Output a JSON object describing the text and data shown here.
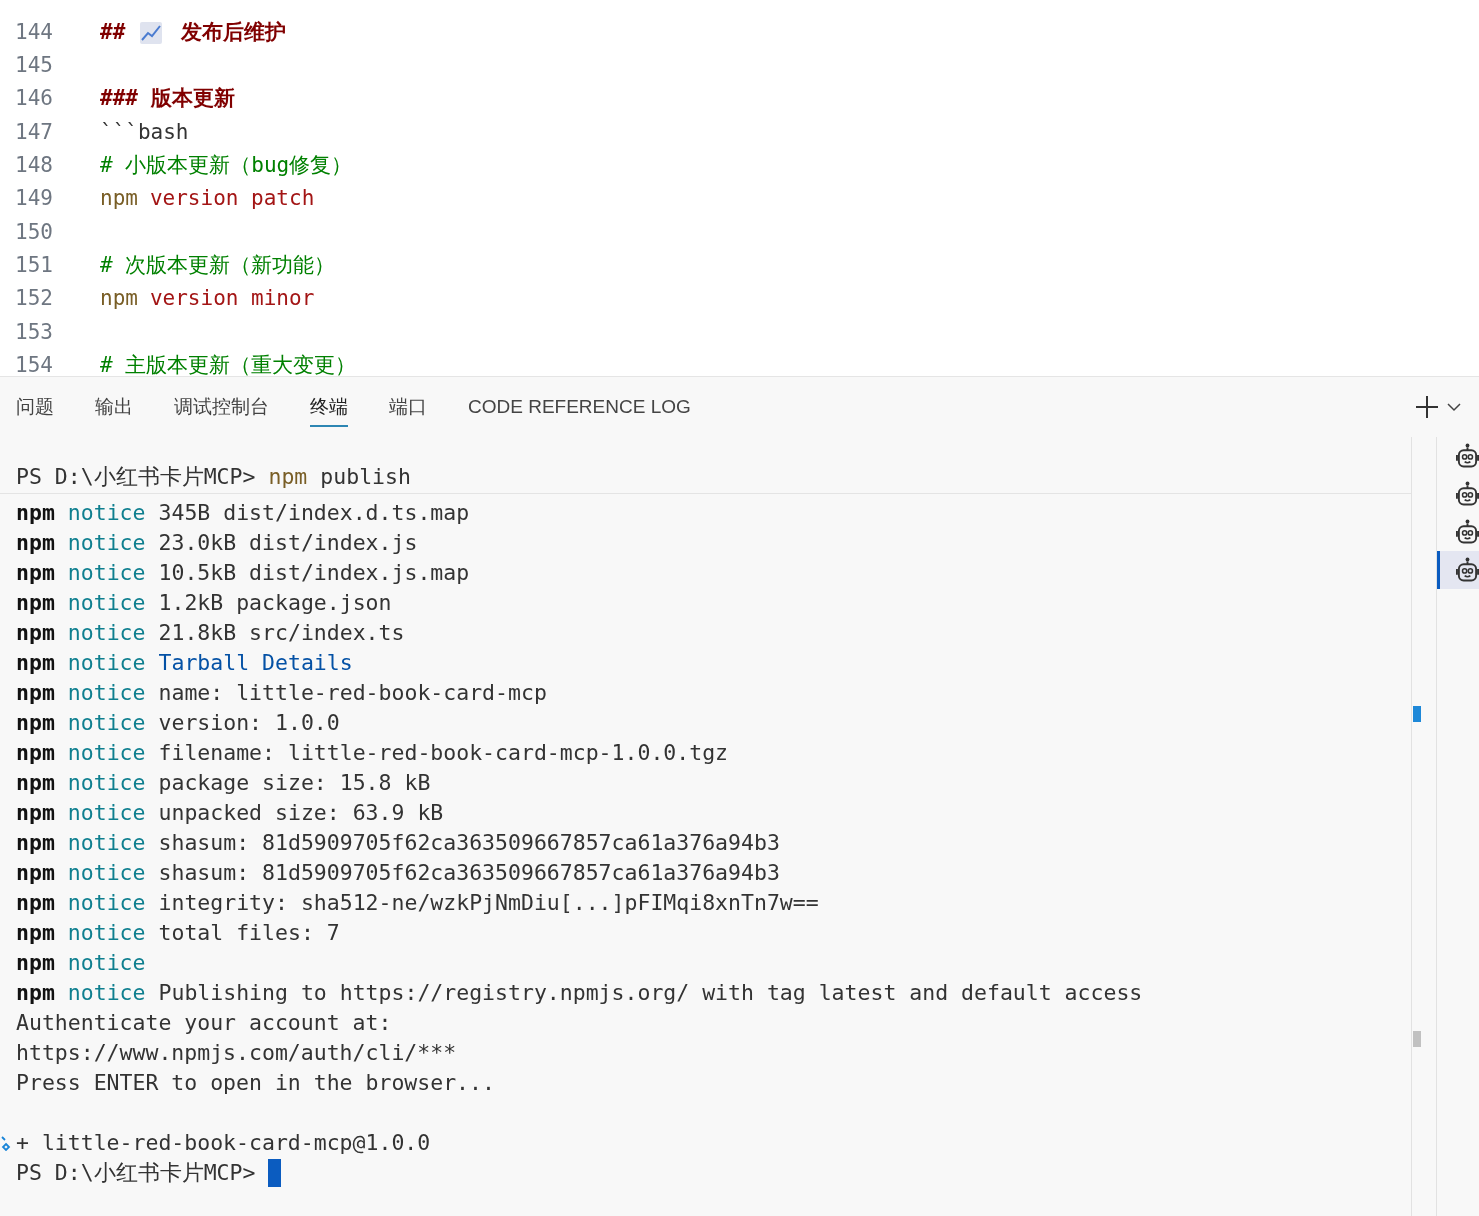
{
  "editor": {
    "lines": [
      {
        "number": "144",
        "segments": [
          {
            "kind": "heading",
            "text": "##"
          },
          {
            "kind": "chart-icon"
          },
          {
            "kind": "heading",
            "text": "发布后维护"
          }
        ]
      },
      {
        "number": "145"
      },
      {
        "number": "146",
        "segments": [
          {
            "kind": "heading",
            "text": "### 版本更新"
          }
        ]
      },
      {
        "number": "147",
        "segments": [
          {
            "kind": "plain",
            "text": "```bash"
          }
        ]
      },
      {
        "number": "148",
        "segments": [
          {
            "kind": "comment",
            "text": "# 小版本更新（bug修复）"
          }
        ]
      },
      {
        "number": "149",
        "segments": [
          {
            "kind": "command",
            "text": "npm"
          },
          {
            "kind": "keyword",
            "text": "version patch"
          }
        ]
      },
      {
        "number": "150"
      },
      {
        "number": "151",
        "segments": [
          {
            "kind": "comment",
            "text": "# 次版本更新（新功能）"
          }
        ]
      },
      {
        "number": "152",
        "segments": [
          {
            "kind": "command",
            "text": "npm"
          },
          {
            "kind": "keyword",
            "text": "version minor"
          }
        ]
      },
      {
        "number": "153"
      },
      {
        "number": "154",
        "segments": [
          {
            "kind": "comment",
            "text": "# 主版本更新（重大变更）"
          }
        ]
      }
    ]
  },
  "panel": {
    "tabs": [
      {
        "label": "问题",
        "selected": false
      },
      {
        "label": "输出",
        "selected": false
      },
      {
        "label": "调试控制台",
        "selected": false
      },
      {
        "label": "终端",
        "selected": true
      },
      {
        "label": "端口",
        "selected": false
      },
      {
        "label": "CODE REFERENCE LOG",
        "selected": false
      }
    ],
    "terminals": [
      {
        "selected": false
      },
      {
        "selected": false
      },
      {
        "selected": false
      },
      {
        "selected": true
      }
    ]
  },
  "terminal": {
    "sticky": {
      "segments": [
        {
          "kind": "text",
          "text": "PS D:\\小红书卡片MCP>"
        },
        {
          "kind": "command",
          "text": "npm"
        },
        {
          "kind": "text",
          "text": "publish"
        }
      ]
    },
    "lines": [
      {
        "segments": [
          {
            "kind": "npm",
            "text": "npm"
          },
          {
            "kind": "notice",
            "text": "notice"
          },
          {
            "kind": "text",
            "text": "345B dist/index.d.ts.map"
          }
        ]
      },
      {
        "segments": [
          {
            "kind": "npm",
            "text": "npm"
          },
          {
            "kind": "notice",
            "text": "notice"
          },
          {
            "kind": "text",
            "text": "23.0kB dist/index.js"
          }
        ]
      },
      {
        "segments": [
          {
            "kind": "npm",
            "text": "npm"
          },
          {
            "kind": "notice",
            "text": "notice"
          },
          {
            "kind": "text",
            "text": "10.5kB dist/index.js.map"
          }
        ]
      },
      {
        "segments": [
          {
            "kind": "npm",
            "text": "npm"
          },
          {
            "kind": "notice",
            "text": "notice"
          },
          {
            "kind": "text",
            "text": "1.2kB package.json"
          }
        ]
      },
      {
        "segments": [
          {
            "kind": "npm",
            "text": "npm"
          },
          {
            "kind": "notice",
            "text": "notice"
          },
          {
            "kind": "text",
            "text": "21.8kB src/index.ts"
          }
        ]
      },
      {
        "segments": [
          {
            "kind": "npm",
            "text": "npm"
          },
          {
            "kind": "notice",
            "text": "notice"
          },
          {
            "kind": "title",
            "text": "Tarball Details"
          }
        ]
      },
      {
        "segments": [
          {
            "kind": "npm",
            "text": "npm"
          },
          {
            "kind": "notice",
            "text": "notice"
          },
          {
            "kind": "text",
            "text": "name: little-red-book-card-mcp"
          }
        ]
      },
      {
        "segments": [
          {
            "kind": "npm",
            "text": "npm"
          },
          {
            "kind": "notice",
            "text": "notice"
          },
          {
            "kind": "text",
            "text": "version: 1.0.0"
          }
        ]
      },
      {
        "segments": [
          {
            "kind": "npm",
            "text": "npm"
          },
          {
            "kind": "notice",
            "text": "notice"
          },
          {
            "kind": "text",
            "text": "filename: little-red-book-card-mcp-1.0.0.tgz"
          }
        ]
      },
      {
        "segments": [
          {
            "kind": "npm",
            "text": "npm"
          },
          {
            "kind": "notice",
            "text": "notice"
          },
          {
            "kind": "text",
            "text": "package size: 15.8 kB"
          }
        ]
      },
      {
        "segments": [
          {
            "kind": "npm",
            "text": "npm"
          },
          {
            "kind": "notice",
            "text": "notice"
          },
          {
            "kind": "text",
            "text": "unpacked size: 63.9 kB"
          }
        ]
      },
      {
        "segments": [
          {
            "kind": "npm",
            "text": "npm"
          },
          {
            "kind": "notice",
            "text": "notice"
          },
          {
            "kind": "text",
            "text": "shasum: 81d5909705f62ca363509667857ca61a376a94b3"
          }
        ]
      },
      {
        "segments": [
          {
            "kind": "npm",
            "text": "npm"
          },
          {
            "kind": "notice",
            "text": "notice"
          },
          {
            "kind": "text",
            "text": "shasum: 81d5909705f62ca363509667857ca61a376a94b3"
          }
        ]
      },
      {
        "segments": [
          {
            "kind": "npm",
            "text": "npm"
          },
          {
            "kind": "notice",
            "text": "notice"
          },
          {
            "kind": "text",
            "text": "integrity: sha512-ne/wzkPjNmDiu[...]pFIMqi8xnTn7w=="
          }
        ]
      },
      {
        "segments": [
          {
            "kind": "npm",
            "text": "npm"
          },
          {
            "kind": "notice",
            "text": "notice"
          },
          {
            "kind": "text",
            "text": "total files: 7"
          }
        ]
      },
      {
        "segments": [
          {
            "kind": "npm",
            "text": "npm"
          },
          {
            "kind": "notice",
            "text": "notice"
          }
        ]
      },
      {
        "segments": [
          {
            "kind": "npm",
            "text": "npm"
          },
          {
            "kind": "notice",
            "text": "notice"
          },
          {
            "kind": "text",
            "text": "Publishing to https://registry.npmjs.org/ with tag latest and default access"
          }
        ]
      },
      {
        "segments": [
          {
            "kind": "text",
            "text": "Authenticate your account at:"
          }
        ]
      },
      {
        "segments": [
          {
            "kind": "text",
            "text": "https://www.npmjs.com/auth/cli/***"
          }
        ]
      },
      {
        "segments": [
          {
            "kind": "text",
            "text": "Press ENTER to open in the browser..."
          }
        ]
      },
      {
        "spaced": true,
        "decorated": true,
        "segments": [
          {
            "kind": "text",
            "text": "+ little-red-book-card-mcp@1.0.0"
          }
        ]
      },
      {
        "cursor": true,
        "segments": [
          {
            "kind": "text",
            "text": "PS D:\\小红书卡片MCP>"
          }
        ]
      }
    ]
  }
}
